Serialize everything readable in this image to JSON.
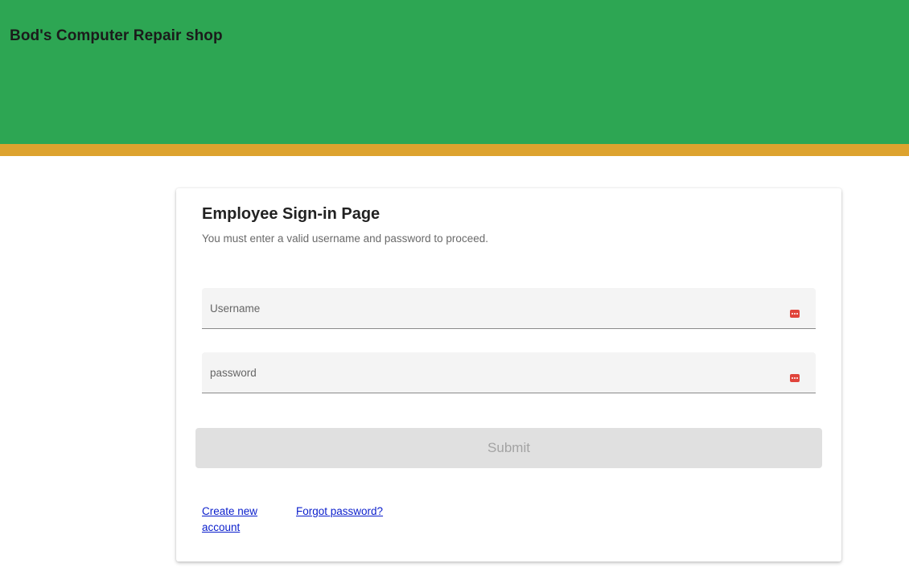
{
  "header": {
    "title": "Bod's Computer Repair shop",
    "background_color": "#2da653",
    "stripe_color": "#dda32f"
  },
  "signin_card": {
    "title": "Employee Sign-in Page",
    "subtitle": "You must enter a valid username and password to proceed.",
    "username_field": {
      "label": "Username",
      "value": "",
      "icon": "password-autofill-icon"
    },
    "password_field": {
      "label": "password",
      "value": "",
      "icon": "password-autofill-icon"
    },
    "submit_label": "Submit",
    "create_account_link": "Create new account",
    "forgot_password_link": "Forgot password?"
  }
}
